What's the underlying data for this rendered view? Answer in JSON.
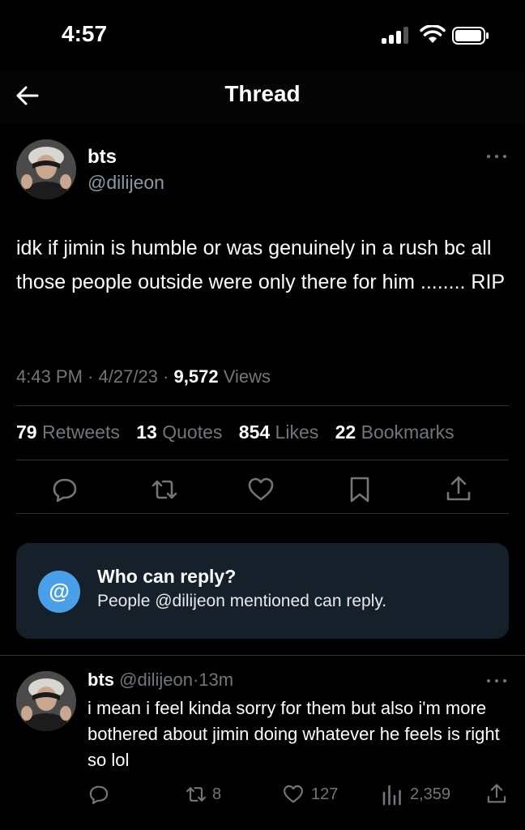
{
  "status_bar": {
    "time": "4:57"
  },
  "header": {
    "title": "Thread"
  },
  "tweet": {
    "author_name": "bts",
    "author_handle": "@dilijeon",
    "text": "idk if jimin is humble or was genuinely in a rush bc all those people outside were only there for him ........ RIP",
    "time": "4:43 PM",
    "date": "4/27/23",
    "views_count": "9,572",
    "views_label": "Views",
    "stats": [
      {
        "count": "79",
        "label": "Retweets"
      },
      {
        "count": "13",
        "label": "Quotes"
      },
      {
        "count": "854",
        "label": "Likes"
      },
      {
        "count": "22",
        "label": "Bookmarks"
      }
    ]
  },
  "who_can_reply": {
    "badge": "@",
    "title": "Who can reply?",
    "subtitle": "People @dilijeon mentioned can reply."
  },
  "reply": {
    "author_name": "bts",
    "author_handle": "@dilijeon",
    "age": "13m",
    "text": "i mean i feel kinda sorry for them but also i'm more bothered about jimin doing whatever he feels is right so lol",
    "retweets": "8",
    "likes": "127",
    "views": "2,359"
  },
  "icons": [
    "back-arrow-icon",
    "reply-icon",
    "retweet-icon",
    "like-icon",
    "bookmark-icon",
    "share-icon",
    "views-icon",
    "more-icon"
  ],
  "colors": {
    "background": "#000000",
    "secondary_text": "#71767b",
    "accent": "#4a9fe9",
    "reply_box": "#16202a"
  }
}
